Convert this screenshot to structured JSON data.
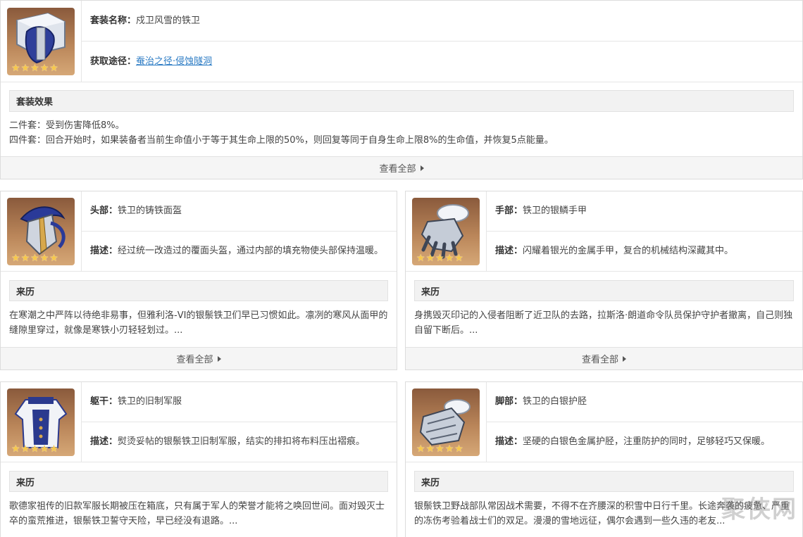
{
  "set": {
    "name_label": "套装名称：",
    "name_value": "戍卫风雪的铁卫",
    "source_label": "获取途径：",
    "source_value": "蚕治之径·侵蚀隧洞",
    "effect_title": "套装效果",
    "effect_2pc": "二件套：受到伤害降低8%。",
    "effect_4pc": "四件套：回合开始时，如果装备者当前生命值小于等于其生命上限的50%，则回复等同于自身生命上限8%的生命值，并恢复5点能量。",
    "view_all": "查看全部",
    "rarity": 5
  },
  "pieces": [
    {
      "slot_label": "头部：",
      "name": "铁卫的铸铁面盔",
      "desc_label": "描述：",
      "desc": "经过统一改造过的覆面头盔，通过内部的填充物使头部保持温暖。",
      "lore_title": "来历",
      "lore": "在寒潮之中严阵以待绝非易事，但雅利洛-VI的银鬃铁卫们早已习惯如此。凛冽的寒风从面甲的缝隙里穿过，就像是寒铁小刃轻轻划过。...",
      "view_all": "查看全部",
      "icon": "helmet-icon"
    },
    {
      "slot_label": "手部：",
      "name": "铁卫的银鳞手甲",
      "desc_label": "描述：",
      "desc": "闪耀着银光的金属手甲，复合的机械结构深藏其中。",
      "lore_title": "来历",
      "lore": "身携毁灭印记的入侵者阻断了近卫队的去路，拉斯洛·朗道命令队员保护守护者撤离，自己则独自留下断后。...",
      "view_all": "查看全部",
      "icon": "gauntlet-icon"
    },
    {
      "slot_label": "躯干：",
      "name": "铁卫的旧制军服",
      "desc_label": "描述：",
      "desc": "熨烫妥帖的银鬃铁卫旧制军服，结实的排扣将布料压出褶痕。",
      "lore_title": "来历",
      "lore": "歌德家祖传的旧款军服长期被压在箱底，只有属于军人的荣誉才能将之唤回世间。面对毁灭士卒的蛮荒推进，银鬃铁卫誓守天险，早已经没有退路。...",
      "icon": "uniform-icon"
    },
    {
      "slot_label": "脚部：",
      "name": "铁卫的白银护胫",
      "desc_label": "描述：",
      "desc": "坚硬的白银色金属护胫，注重防护的同时，足够轻巧又保暖。",
      "lore_title": "来历",
      "lore": "银鬃铁卫野战部队常因战术需要，不得不在齐腰深的积雪中日行千里。长途奔袭的疲惫、严重的冻伤考验着战士们的双足。漫漫的雪地远征，偶尔会遇到一些久违的老友...",
      "icon": "greaves-icon"
    }
  ],
  "watermark": "聚侠网"
}
